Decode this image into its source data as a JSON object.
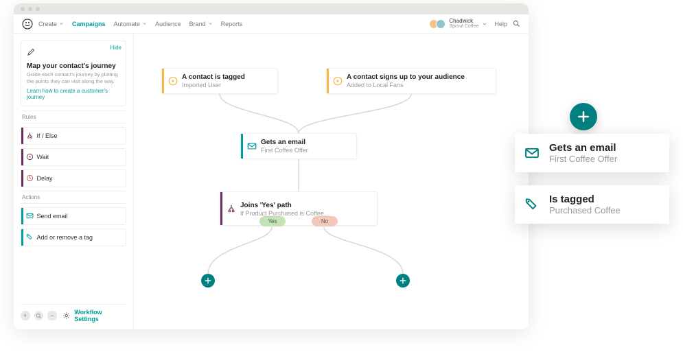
{
  "nav": {
    "create": "Create",
    "campaigns": "Campaigns",
    "automate": "Automate",
    "audience": "Audience",
    "brand": "Brand",
    "reports": "Reports",
    "user_name": "Chadwick",
    "user_org": "Sprout Coffee",
    "help": "Help"
  },
  "sidebar": {
    "hide": "Hide",
    "journey_title": "Map your contact's journey",
    "journey_desc": "Guide each contact's journey by plotting the points they can visit along the way.",
    "journey_link": "Learn how to create a customer's journey",
    "rules_h": "Rules",
    "actions_h": "Actions",
    "rules": [
      {
        "label": "If / Else"
      },
      {
        "label": "Wait"
      },
      {
        "label": "Delay"
      }
    ],
    "actions": [
      {
        "label": "Send email"
      },
      {
        "label": "Add or remove a tag"
      }
    ],
    "workflow_settings": "Workflow Settings"
  },
  "canvas": {
    "trigger1": {
      "title": "A contact is tagged",
      "sub": "Imported User"
    },
    "trigger2": {
      "title": "A contact signs up to your audience",
      "sub": "Added to Local Fans"
    },
    "email": {
      "title": "Gets an email",
      "sub": "First Coffee Offer"
    },
    "split": {
      "title": "Joins 'Yes' path",
      "sub": "If Product Purchased is Coffee..."
    },
    "yes": "Yes",
    "no": "No"
  },
  "overlay": {
    "card1": {
      "title": "Gets an  email",
      "sub": "First Coffee Offer"
    },
    "card2": {
      "title": "Is tagged",
      "sub": "Purchased Coffee"
    }
  },
  "colors": {
    "teal": "#008080",
    "teal_text": "#009e9a",
    "orange": "#f5b945",
    "purple": "#6a2c5f"
  }
}
